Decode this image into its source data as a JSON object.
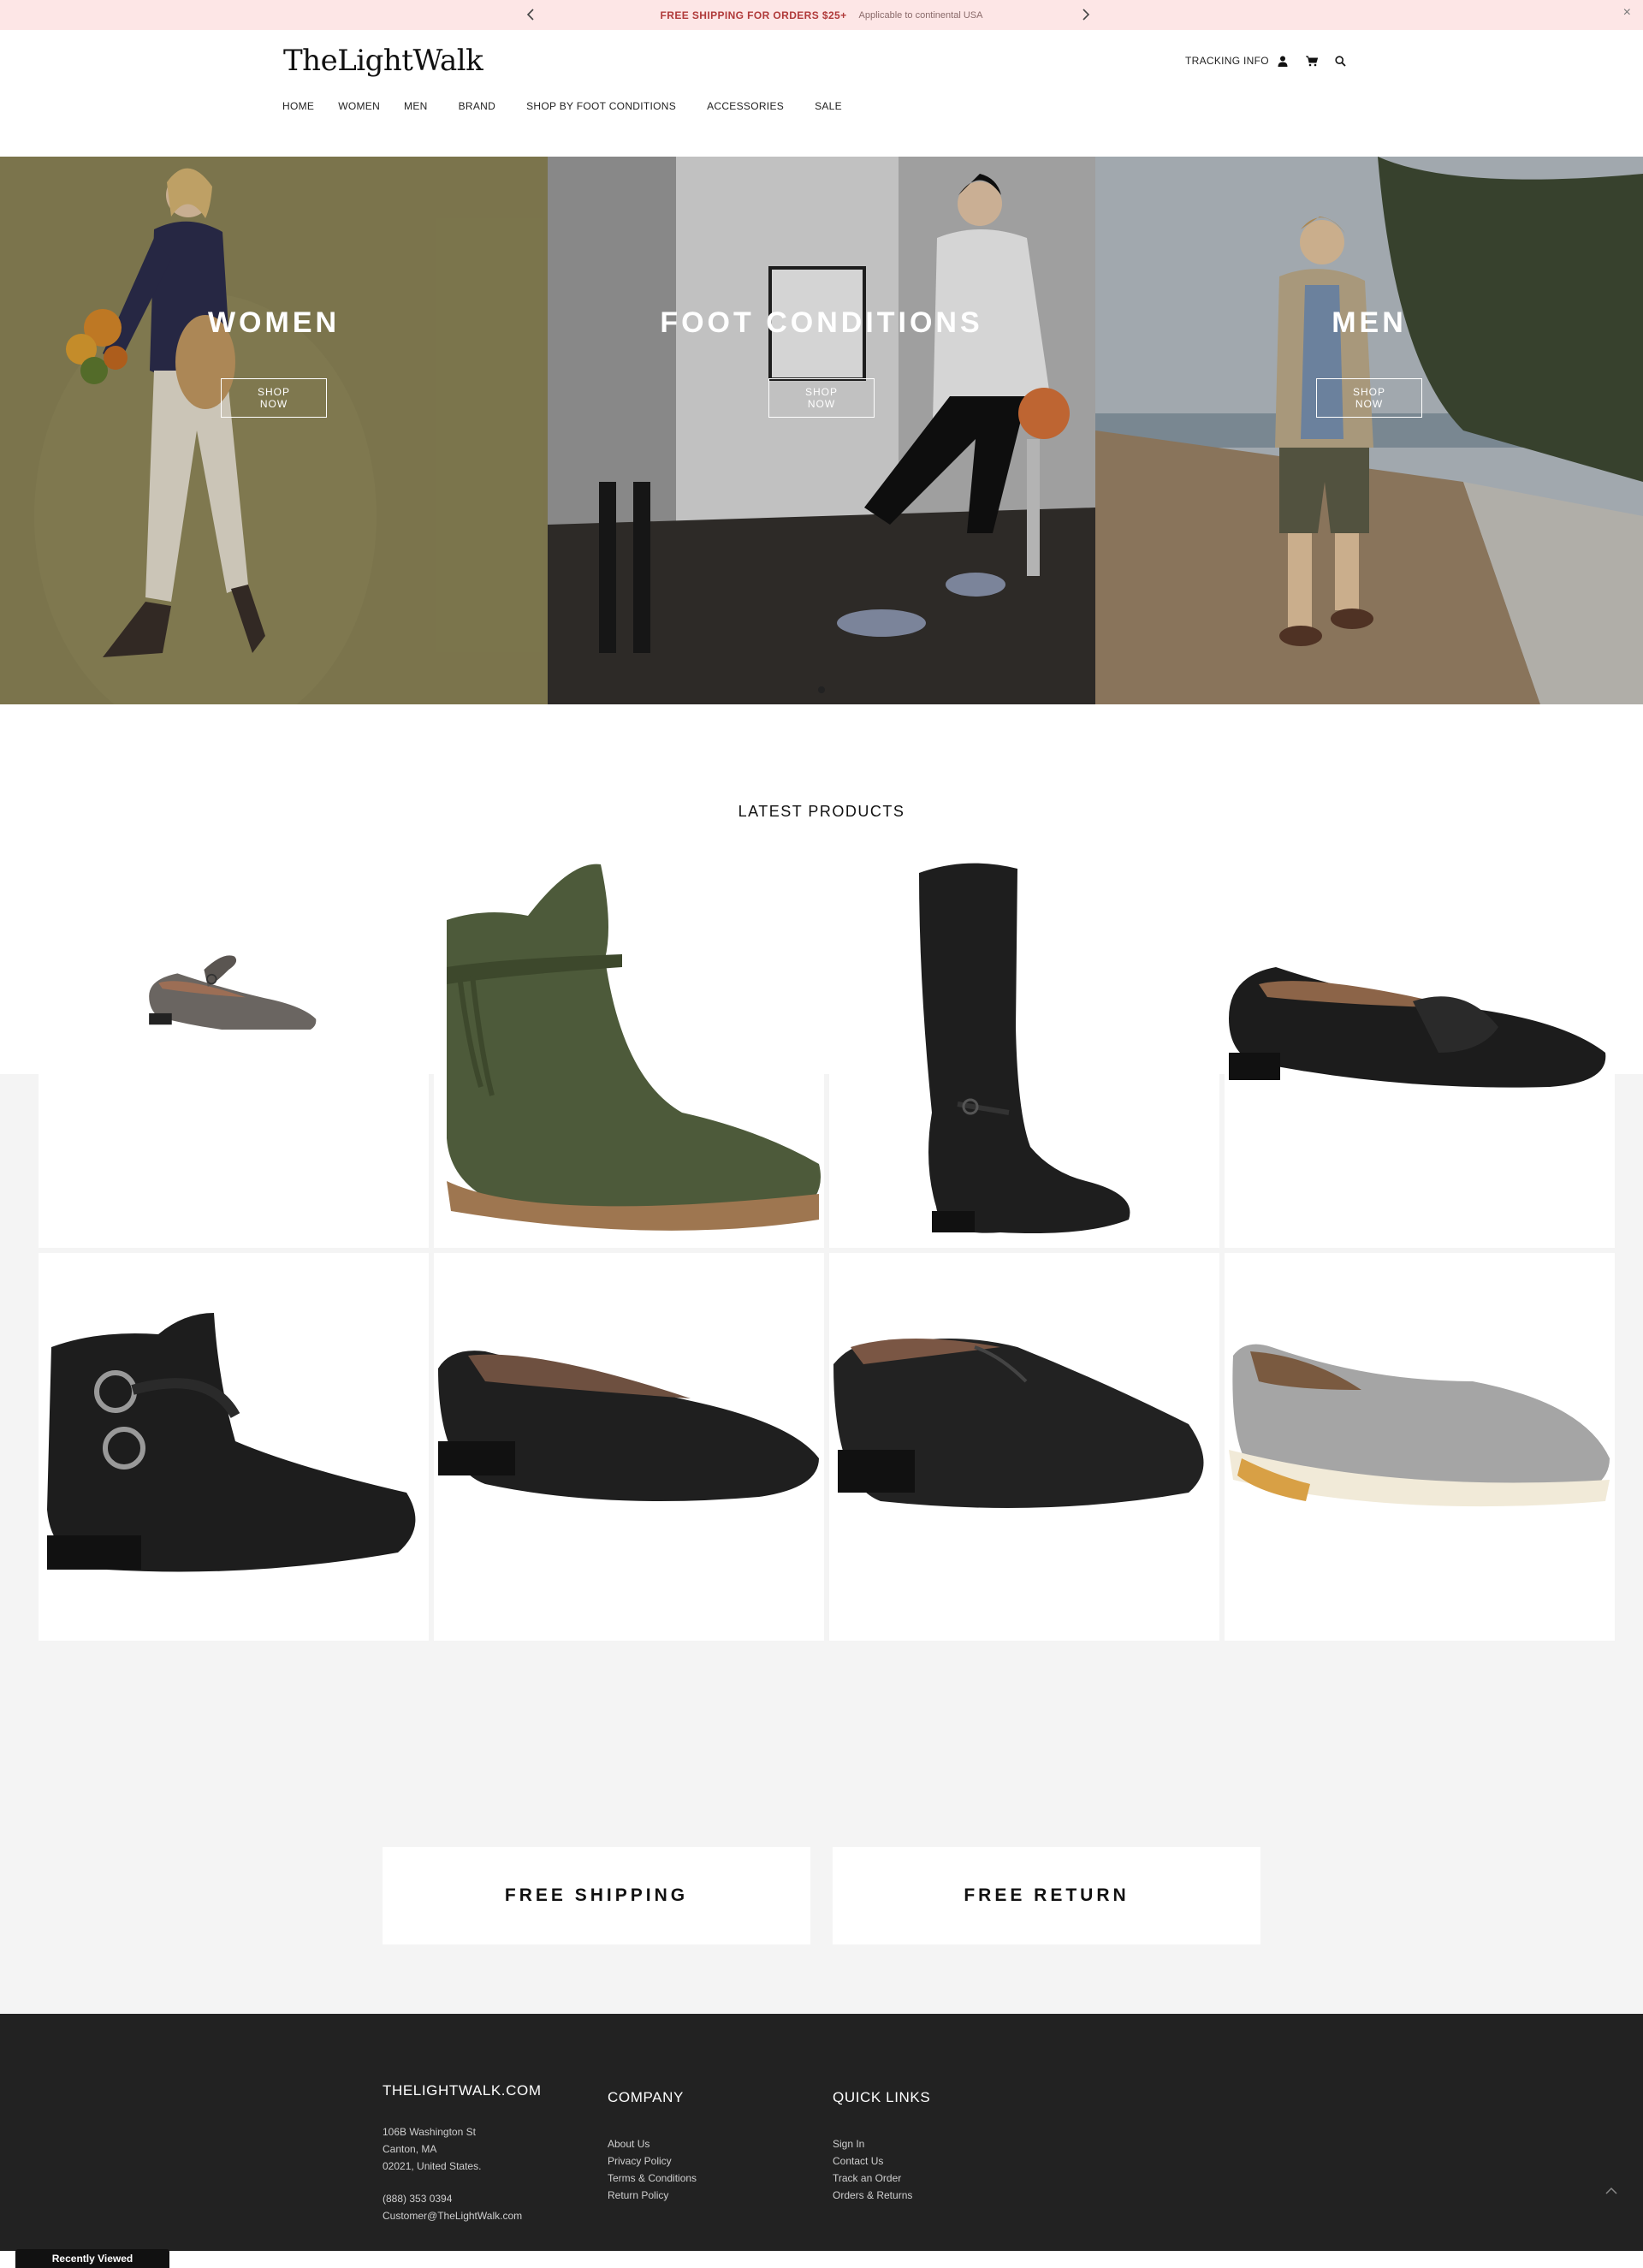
{
  "announcement": {
    "message": "FREE SHIPPING FOR ORDERS $25+",
    "sub": "Applicable to continental USA",
    "prev_icon": "chevron-left-icon",
    "next_icon": "chevron-right-icon",
    "close_label": "×"
  },
  "header": {
    "logo": "TheLightWalk",
    "tracking_label": "TRACKING INFO",
    "icons": [
      "user-icon",
      "cart-icon",
      "search-icon"
    ]
  },
  "nav": {
    "items": [
      "HOME",
      "WOMEN",
      "MEN",
      "BRAND",
      "SHOP BY FOOT CONDITIONS",
      "ACCESSORIES",
      "SALE"
    ]
  },
  "hero": {
    "panels": [
      {
        "title": "WOMEN",
        "button": "SHOP NOW"
      },
      {
        "title": "FOOT CONDITIONS",
        "button": "SHOP NOW"
      },
      {
        "title": "MEN",
        "button": "SHOP NOW"
      }
    ]
  },
  "latest": {
    "title": "LATEST PRODUCTS",
    "products": [
      {
        "name": "mary-jane-flat",
        "color": "#6a6561"
      },
      {
        "name": "olive-ankle-boot",
        "color": "#4d5a3a"
      },
      {
        "name": "tall-black-boot",
        "color": "#1e1e1e"
      },
      {
        "name": "black-knot-flat",
        "color": "#1c1c1c"
      },
      {
        "name": "buckle-bootie",
        "color": "#1d1d1d"
      },
      {
        "name": "black-skimmer-flat",
        "color": "#1f1f1f"
      },
      {
        "name": "black-oxford",
        "color": "#222222"
      },
      {
        "name": "grey-slip-on-sneaker",
        "color": "#a5a5a5"
      }
    ]
  },
  "perks": {
    "shipping": "FREE SHIPPING",
    "returns": "FREE RETURN"
  },
  "footer": {
    "brand": {
      "title": "THELIGHTWALK.COM",
      "address_1": "106B Washington St",
      "address_2": "Canton, MA",
      "address_3": "02021, United States.",
      "phone": "(888) 353 0394",
      "email": "Customer@TheLightWalk.com"
    },
    "company": {
      "title": "COMPANY",
      "links": [
        "About Us",
        "Privacy Policy",
        "Terms & Conditions",
        "Return Policy"
      ]
    },
    "quick": {
      "title": "QUICK LINKS",
      "links": [
        "Sign In",
        "Contact Us",
        "Track an Order",
        "Orders & Returns"
      ]
    }
  },
  "recently_viewed": "Recently Viewed",
  "colors": {
    "announce_bg": "#fde6e6",
    "footer_bg": "#222222",
    "grey_band": "#f4f4f4"
  }
}
